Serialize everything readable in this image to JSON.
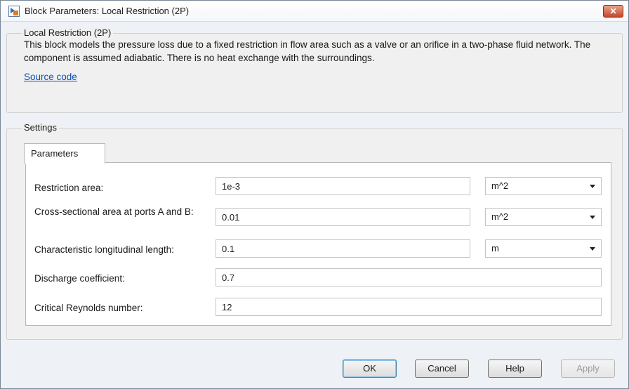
{
  "window": {
    "title": "Block Parameters: Local Restriction (2P)",
    "close_glyph": "✕"
  },
  "block_group": {
    "label": "Local Restriction (2P)",
    "description": "This block models the pressure loss due to a fixed restriction in flow area such as a valve or an orifice in a two-phase fluid network. The component is assumed adiabatic. There is no heat exchange with the surroundings.",
    "source_link": "Source code"
  },
  "settings": {
    "label": "Settings",
    "tabs": [
      {
        "label": "Parameters",
        "selected": true
      }
    ],
    "params": [
      {
        "label": "Restriction area:",
        "value": "1e-3",
        "unit": "m^2"
      },
      {
        "label": "Cross-sectional area at ports A and B:",
        "value": "0.01",
        "unit": "m^2"
      },
      {
        "label": "Characteristic longitudinal length:",
        "value": "0.1",
        "unit": "m"
      },
      {
        "label": "Discharge coefficient:",
        "value": "0.7"
      },
      {
        "label": "Critical Reynolds number:",
        "value": "12"
      }
    ]
  },
  "buttons": {
    "ok": "OK",
    "cancel": "Cancel",
    "help": "Help",
    "apply": "Apply"
  },
  "icons": {
    "app": "simulink-block-icon",
    "close": "close-icon",
    "dropdown": "chevron-down-icon"
  }
}
